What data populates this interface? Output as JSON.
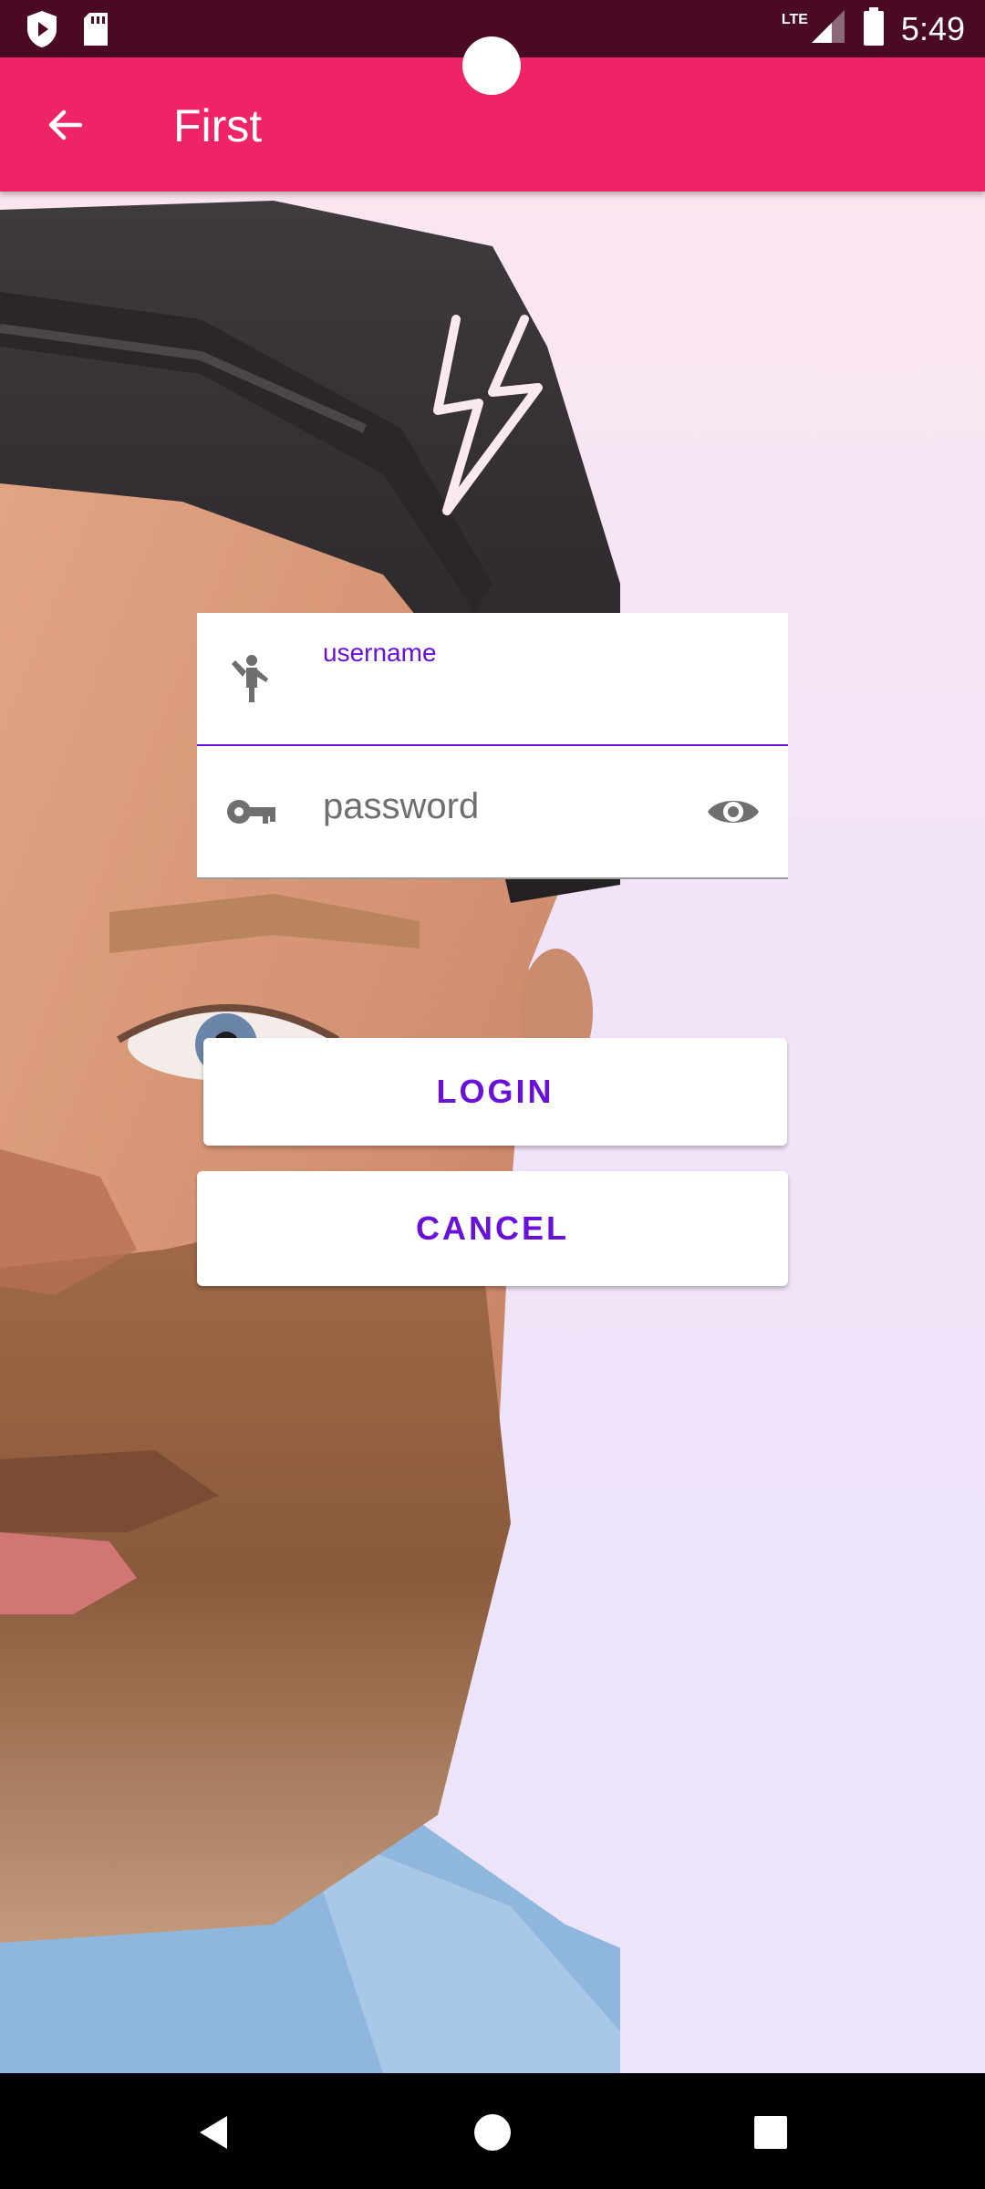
{
  "status_bar": {
    "time": "5:49",
    "network_label": "LTE",
    "icons": [
      "play-protect-icon",
      "sd-card-icon",
      "signal-icon",
      "battery-icon"
    ]
  },
  "app_bar": {
    "title": "First",
    "back_icon": "arrow-back-icon",
    "color": "#ef2466"
  },
  "login_form": {
    "username": {
      "label": "username",
      "value": "",
      "icon": "person-waving-icon"
    },
    "password": {
      "placeholder": "password",
      "value": "",
      "icon": "key-icon",
      "toggle_icon": "eye-icon"
    },
    "accent_color": "#6a11d9"
  },
  "buttons": {
    "login_label": "LOGIN",
    "cancel_label": "CANCEL"
  },
  "nav_bar": {
    "icons": [
      "back-triangle-icon",
      "home-circle-icon",
      "recents-square-icon"
    ]
  }
}
